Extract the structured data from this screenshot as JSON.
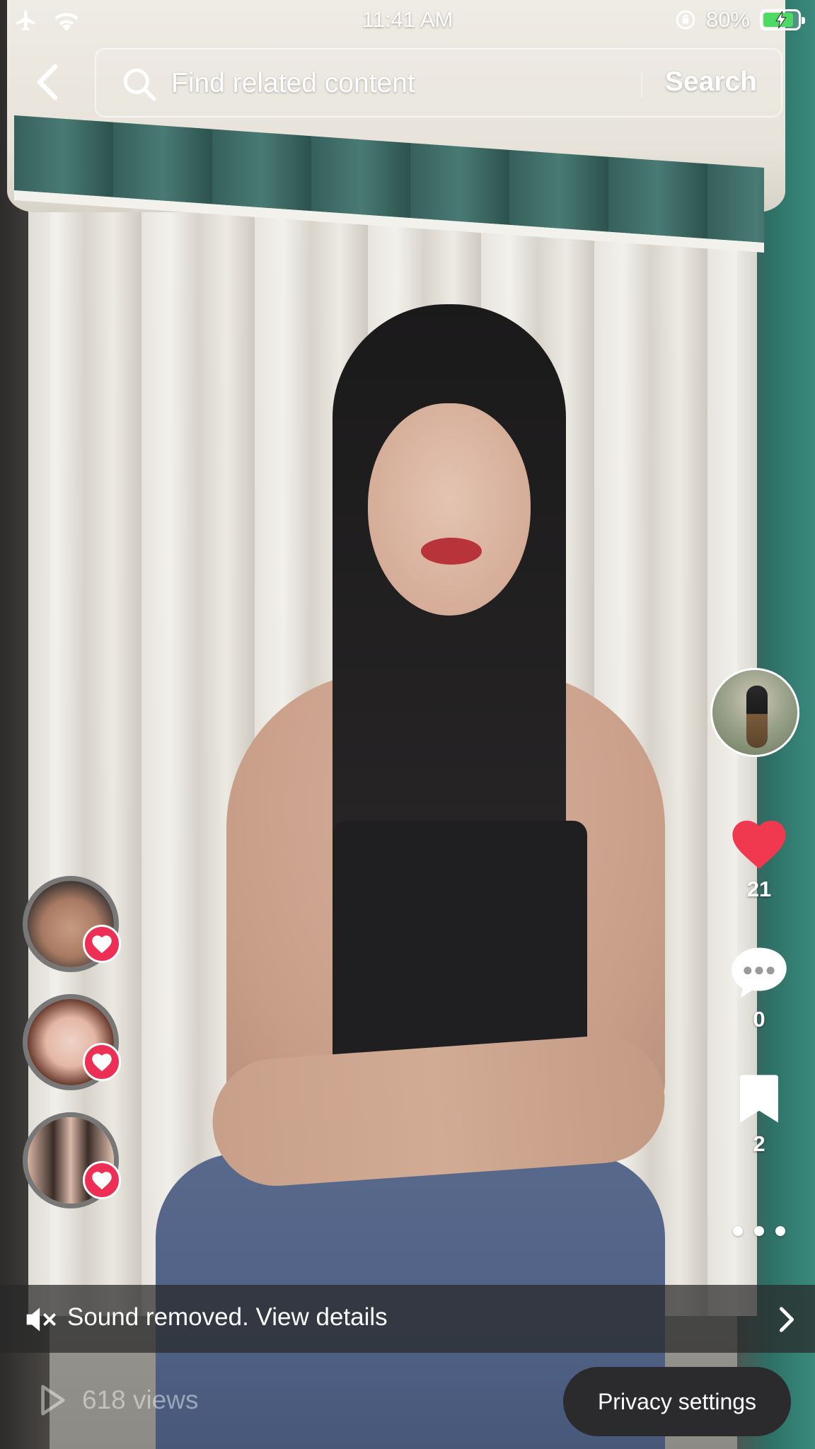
{
  "status_bar": {
    "time": "11:41 AM",
    "battery_percent": "80%",
    "battery_level": 0.8,
    "icons": [
      "airplane-mode-icon",
      "wifi-icon",
      "orientation-lock-icon",
      "battery-charging-icon"
    ]
  },
  "search": {
    "placeholder": "Find related content",
    "button_label": "Search"
  },
  "actions": {
    "likes": "21",
    "comments": "0",
    "bookmarks": "2"
  },
  "likers": [
    {
      "icon": "heart-icon"
    },
    {
      "icon": "heart-icon"
    },
    {
      "icon": "heart-icon"
    }
  ],
  "sound_banner": {
    "text": "Sound removed. View details"
  },
  "bottom": {
    "views": "618 views",
    "privacy_button": "Privacy settings"
  },
  "colors": {
    "like_red": "#ee2f55",
    "heart_fill": "#f0394f",
    "battery_green": "#4cd964"
  }
}
